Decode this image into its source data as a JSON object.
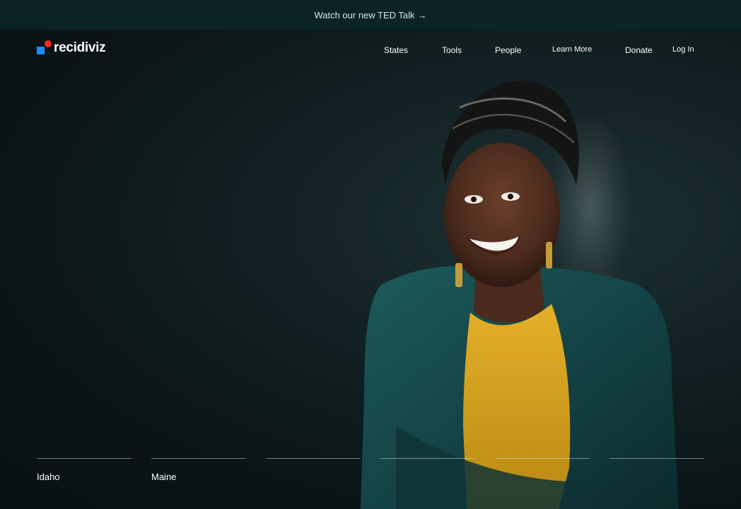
{
  "announcement": {
    "text": "Watch our new TED Talk",
    "arrow": "→"
  },
  "brand": {
    "name": "recidiviz",
    "colors": {
      "square": "#1a8cff",
      "dot": "#ff2a1a"
    }
  },
  "nav": {
    "items": [
      {
        "label": "States"
      },
      {
        "label": "Tools"
      },
      {
        "label": "People"
      },
      {
        "label": "Learn More"
      },
      {
        "label": "Donate"
      },
      {
        "label": "Log In"
      }
    ]
  },
  "hero": {
    "image": "portrait-photo",
    "colors": {
      "jacket": "#14484a",
      "top": "#d9a21b",
      "background": "#0b1a1c"
    }
  },
  "states": [
    {
      "label": "Idaho"
    },
    {
      "label": "Maine"
    },
    {
      "label": ""
    },
    {
      "label": ""
    },
    {
      "label": ""
    },
    {
      "label": ""
    }
  ]
}
